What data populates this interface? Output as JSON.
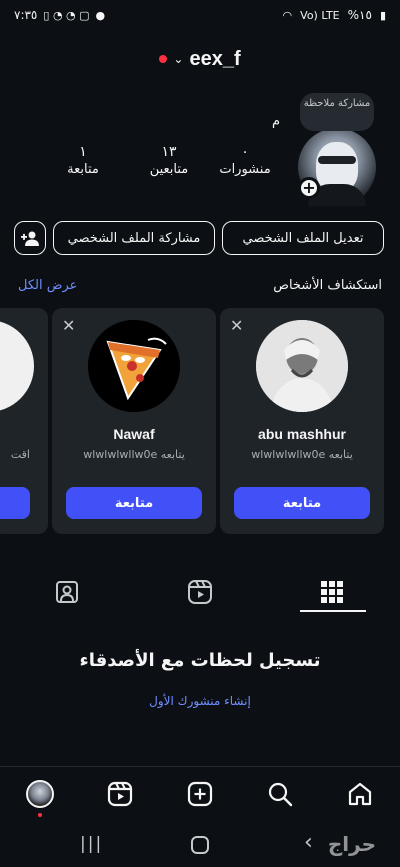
{
  "status_bar": {
    "time": "٧:٣٥",
    "battery": "%١٥",
    "volte": "Vo) LTE"
  },
  "header": {
    "username": "eex_f"
  },
  "profile": {
    "note": "مشاركة ملاحظة",
    "name": "م",
    "stats": {
      "posts_count": "٠",
      "posts_label": "منشورات",
      "followers_count": "١٣",
      "followers_label": "متابعين",
      "following_count": "١",
      "following_label": "متابعة"
    }
  },
  "actions": {
    "edit_label": "تعديل الملف الشخصي",
    "share_label": "مشاركة الملف الشخصي"
  },
  "discover": {
    "title": "استكشاف الأشخاص",
    "see_all": "عرض الكل",
    "cards": [
      {
        "name": "abu mashhur",
        "subtitle": "يتابعه wlwlwlwllw0e",
        "follow_label": "متابعة"
      },
      {
        "name": "Nawaf",
        "subtitle": "يتابعه wlwlwlwllw0e",
        "follow_label": "متابعة"
      },
      {
        "name": "",
        "subtitle": "اقت",
        "follow_label": ""
      }
    ]
  },
  "empty_state": {
    "title": "تسجيل لحظات مع الأصدقاء",
    "link": "إنشاء منشورك الأول"
  },
  "watermark": "حراج",
  "colors": {
    "background": "#0c1014",
    "accent": "#4150f7",
    "link": "#708dff",
    "card": "#1f2429",
    "live_dot": "#ff3040"
  }
}
